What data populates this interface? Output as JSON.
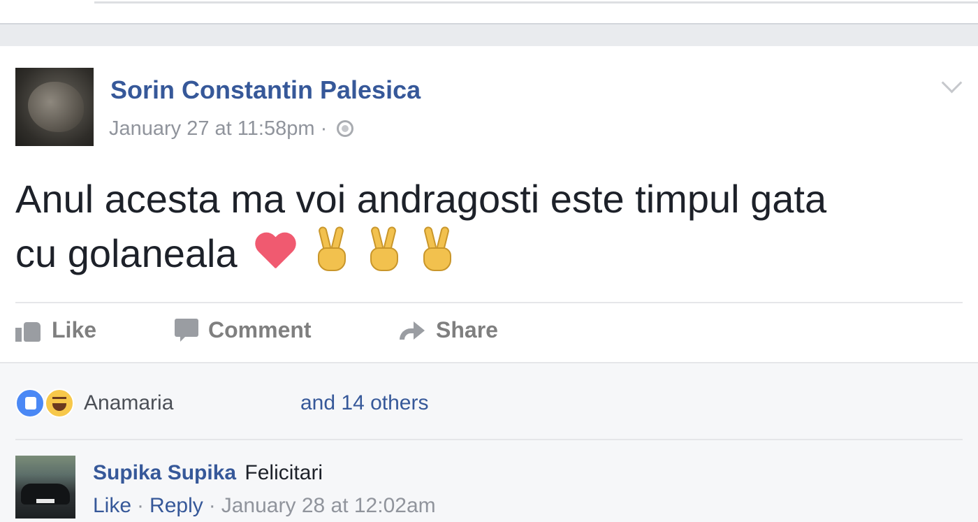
{
  "post": {
    "author": "Sorin Constantin Palesica",
    "timestamp": "January 27 at 11:58pm",
    "meta_separator": "·",
    "privacy_icon": "globe-icon",
    "text_line1": "Anul acesta ma voi andragosti este timpul gata",
    "text_line2": "cu golaneala",
    "emojis": [
      "heart-icon",
      "victory-hand-icon",
      "victory-hand-icon",
      "victory-hand-icon"
    ]
  },
  "actions": {
    "like_label": "Like",
    "comment_label": "Comment",
    "share_label": "Share"
  },
  "reactions": {
    "icons": [
      "like-reaction-icon",
      "haha-reaction-icon"
    ],
    "first_name": "Anamaria",
    "others": "and 14 others"
  },
  "comment": {
    "author": "Supika Supika",
    "text": "Felicitari",
    "like_label": "Like",
    "reply_label": "Reply",
    "separator": "·",
    "timestamp": "January 28 at 12:02am"
  },
  "colors": {
    "link_blue": "#365899",
    "meta_gray": "#90949c",
    "page_bg": "#e9ebee",
    "heart": "#f05a70"
  }
}
